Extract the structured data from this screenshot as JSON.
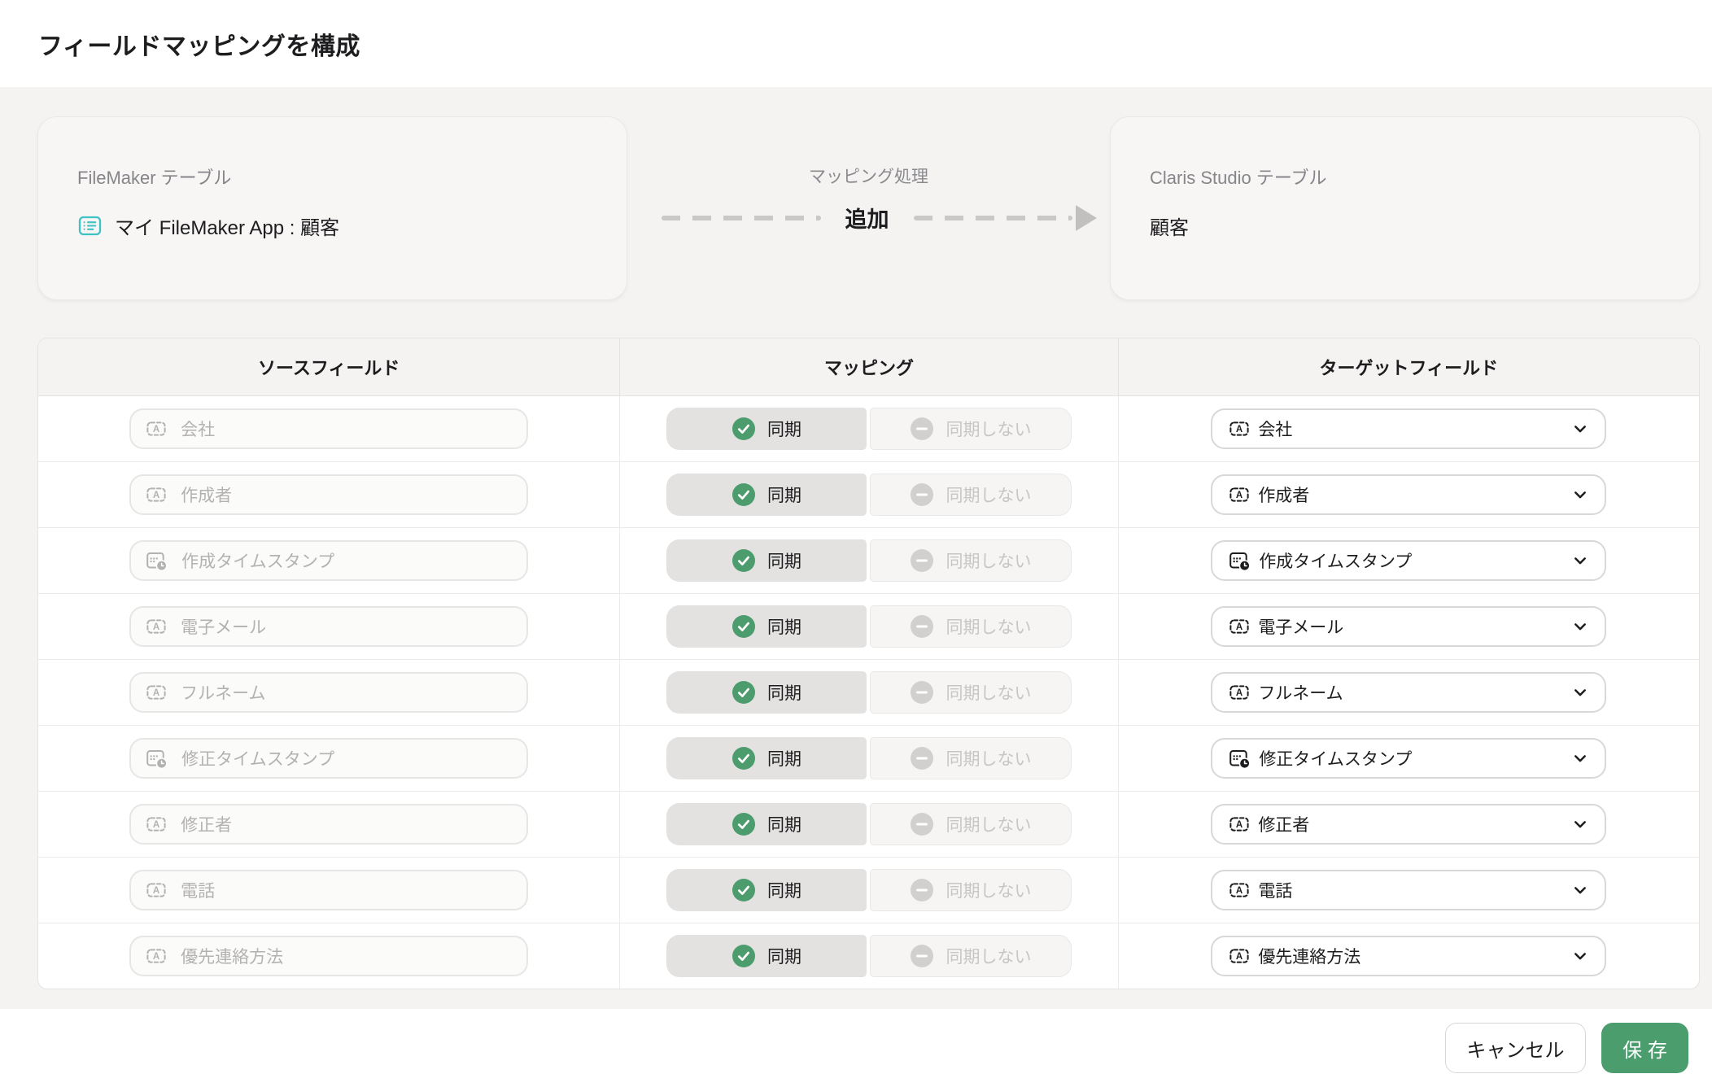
{
  "title": "フィールドマッピングを構成",
  "source_card": {
    "label": "FileMaker テーブル",
    "value": "マイ FileMaker App : 顧客",
    "icon": "table-list-icon",
    "icon_color": "#3fc2c4"
  },
  "process": {
    "label": "マッピング処理",
    "action": "追加",
    "arrow_icon": "arrow-right-icon"
  },
  "target_card": {
    "label": "Claris Studio テーブル",
    "value": "顧客"
  },
  "table": {
    "headers": [
      "ソースフィールド",
      "マッピング",
      "ターゲットフィールド"
    ],
    "sync_on_label": "同期",
    "sync_off_label": "同期しない",
    "sync_on_icon": "check-circle-icon",
    "sync_off_icon": "minus-circle-icon",
    "rows": [
      {
        "source": "会社",
        "source_icon": "text-field-icon",
        "sync": "同期",
        "target": "会社",
        "target_icon": "text-field-icon"
      },
      {
        "source": "作成者",
        "source_icon": "text-field-icon",
        "sync": "同期",
        "target": "作成者",
        "target_icon": "text-field-icon"
      },
      {
        "source": "作成タイムスタンプ",
        "source_icon": "timestamp-field-icon",
        "sync": "同期",
        "target": "作成タイムスタンプ",
        "target_icon": "timestamp-field-icon"
      },
      {
        "source": "電子メール",
        "source_icon": "text-field-icon",
        "sync": "同期",
        "target": "電子メール",
        "target_icon": "text-field-icon"
      },
      {
        "source": "フルネーム",
        "source_icon": "text-field-icon",
        "sync": "同期",
        "target": "フルネーム",
        "target_icon": "text-field-icon"
      },
      {
        "source": "修正タイムスタンプ",
        "source_icon": "timestamp-field-icon",
        "sync": "同期",
        "target": "修正タイムスタンプ",
        "target_icon": "timestamp-field-icon"
      },
      {
        "source": "修正者",
        "source_icon": "text-field-icon",
        "sync": "同期",
        "target": "修正者",
        "target_icon": "text-field-icon"
      },
      {
        "source": "電話",
        "source_icon": "text-field-icon",
        "sync": "同期",
        "target": "電話",
        "target_icon": "text-field-icon"
      },
      {
        "source": "優先連絡方法",
        "source_icon": "text-field-icon",
        "sync": "同期",
        "target": "優先連絡方法",
        "target_icon": "text-field-icon"
      }
    ]
  },
  "footer": {
    "cancel_label": "キャンセル",
    "save_label": "保 存"
  },
  "colors": {
    "accent_green": "#4c9d6e",
    "toggle_check_green": "#4d9c6d",
    "toggle_minus_gray": "#d1d0cf",
    "teal": "#3fc2c4"
  }
}
